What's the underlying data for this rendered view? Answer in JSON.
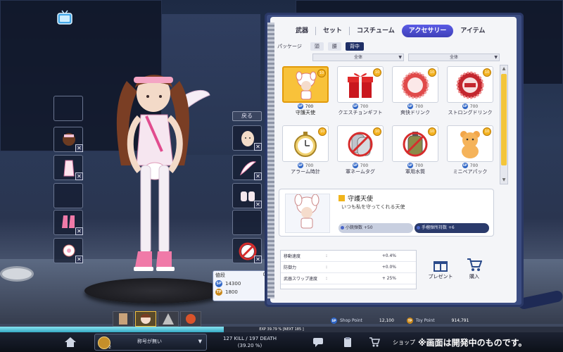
{
  "tabs": [
    {
      "label": "武器",
      "active": false
    },
    {
      "label": "セット",
      "active": false
    },
    {
      "label": "コスチューム",
      "active": false
    },
    {
      "label": "アクセサリー",
      "active": true
    },
    {
      "label": "アイテム",
      "active": false
    }
  ],
  "subtabs": {
    "label": "パッケージ",
    "items": [
      {
        "label": "頭",
        "active": false
      },
      {
        "label": "腰",
        "active": false
      },
      {
        "label": "背中",
        "active": true
      }
    ]
  },
  "filters": [
    "全体",
    "全体"
  ],
  "back_label": "戻る",
  "items": [
    {
      "name": "守護天使",
      "price": "700",
      "level": "10",
      "selected": true,
      "icon": "angel-icon"
    },
    {
      "name": "クエスチョンギフト",
      "price": "700",
      "level": "10",
      "selected": false,
      "icon": "gift-icon"
    },
    {
      "name": "爽快ドリンク",
      "price": "700",
      "level": "10",
      "selected": false,
      "icon": "drink-cap-icon"
    },
    {
      "name": "ストロングドリンク",
      "price": "700",
      "level": "10",
      "selected": false,
      "icon": "strong-drink-cap-icon"
    },
    {
      "name": "アラーム時計",
      "price": "700",
      "level": "10",
      "selected": false,
      "icon": "alarm-clock-icon"
    },
    {
      "name": "軍ネームタグ",
      "price": "700",
      "level": "10",
      "selected": false,
      "icon": "dog-tag-icon"
    },
    {
      "name": "軍用水筒",
      "price": "700",
      "level": "10",
      "selected": false,
      "icon": "canteen-icon"
    },
    {
      "name": "ミニベアパック",
      "price": "700",
      "level": "10",
      "selected": false,
      "icon": "bear-pack-icon"
    }
  ],
  "detail": {
    "title": "守護天使",
    "description": "いつも私を守ってくれる天使",
    "effects": [
      "小銃弾数 +50",
      "手榴弾所持数 +6"
    ]
  },
  "stats": [
    {
      "label": "移動速度",
      "colon": ":",
      "value": "+0.4%"
    },
    {
      "label": "防御力",
      "colon": ":",
      "value": "+0.0%"
    },
    {
      "label": "武器スワップ速度",
      "colon": ":",
      "value": "+ 25%"
    }
  ],
  "actions": {
    "present": "プレゼント",
    "buy": "購入"
  },
  "points": {
    "shop_label": "Shop Point",
    "shop_value": "12,100",
    "toy_label": "Toy Point",
    "toy_value": "914,791"
  },
  "price_tip": {
    "title": "値段",
    "count": "0",
    "sp": "14300",
    "tp": "1800"
  },
  "exp": {
    "label": "EXP",
    "text": "39.79 % [NEXT 185 ]",
    "percent": 39.79
  },
  "player": {
    "level": "2",
    "title": "称号が無い",
    "kd_line1": "127 KILL / 197 DEATH",
    "kd_line2": "(39.20 %)"
  },
  "shop_label": "ショップ",
  "dev_note": "※画面は開発中のものです。",
  "coin_labels": {
    "sp": "SP",
    "tp": "TP"
  },
  "equipment_slots": {
    "left": [
      "",
      "hair-icon",
      "costume-icon",
      "",
      "boots-icon",
      "angel-icon"
    ],
    "right": [
      "face-icon",
      "wing-icon",
      "gloves-icon",
      "",
      "angel-banned-icon"
    ]
  }
}
